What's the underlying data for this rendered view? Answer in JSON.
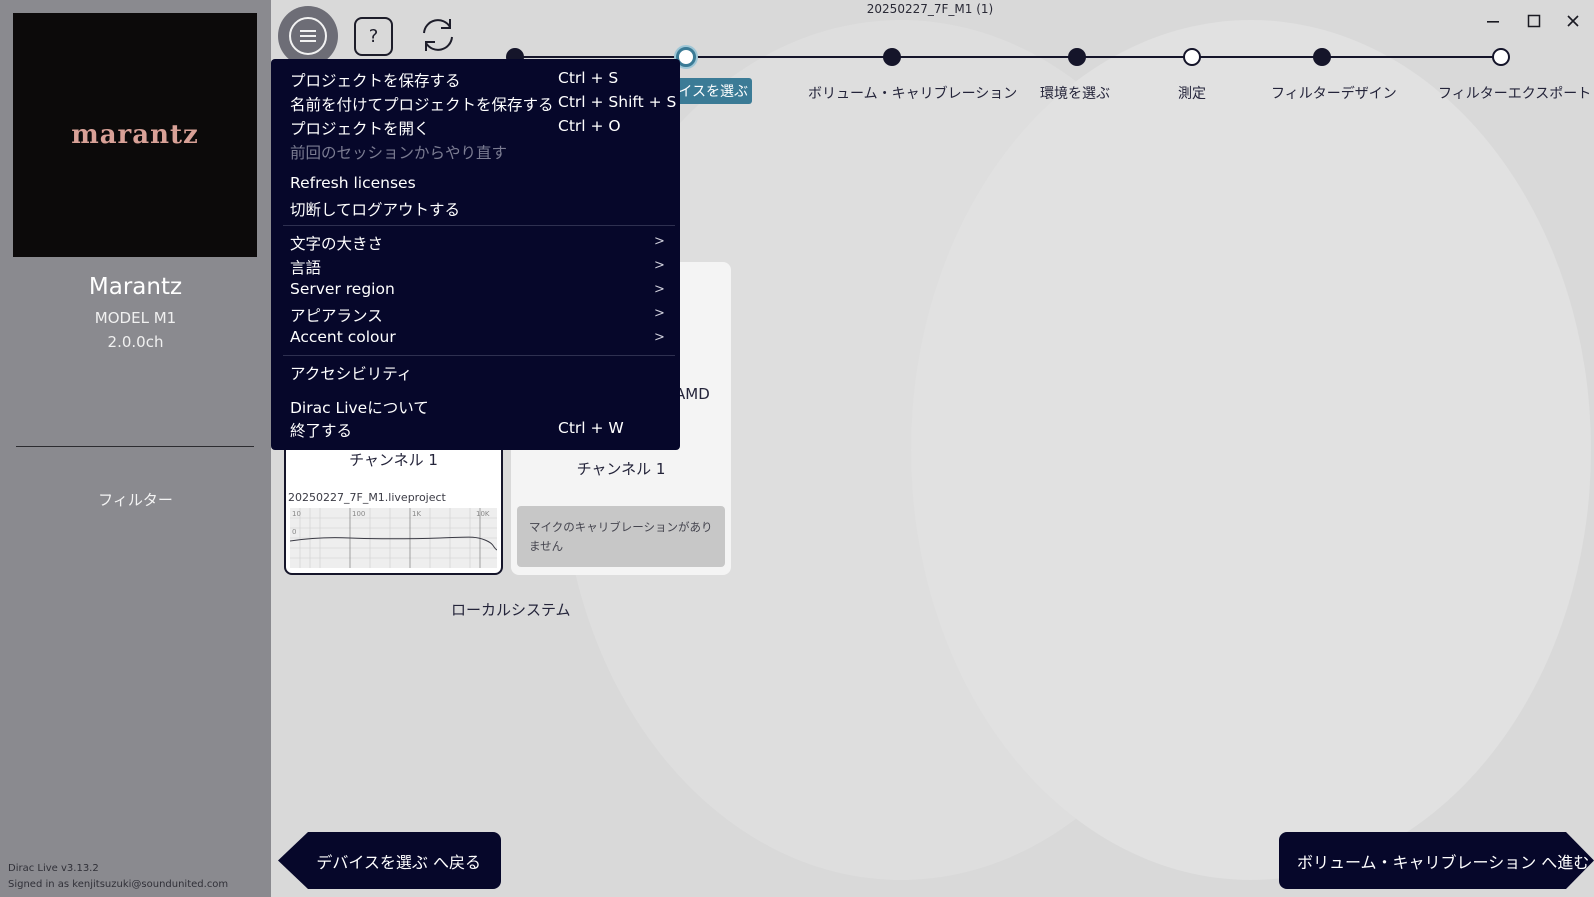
{
  "window": {
    "title": "20250227_7F_M1 (1)"
  },
  "sidebar": {
    "logo_text": "marantz",
    "device_name": "Marantz",
    "device_model": "MODEL M1",
    "device_channels": "2.0.0ch",
    "filter_label": "フィルター",
    "version": "Dirac Live v3.13.2",
    "signed_in": "Signed in as kenjitsuzuki@soundunited.com"
  },
  "toolbar": {
    "help_label": "?"
  },
  "steps": [
    {
      "label": "デバイスを選ぶ",
      "state": "current"
    },
    {
      "label": "ボリューム・キャリブレーション",
      "state": "done"
    },
    {
      "label": "環境を選ぶ",
      "state": "done"
    },
    {
      "label": "測定",
      "state": "todo"
    },
    {
      "label": "フィルターデザイン",
      "state": "done"
    },
    {
      "label": "フィルターエクスポート",
      "state": "todo"
    }
  ],
  "menu": {
    "items": [
      {
        "label": "プロジェクトを保存する",
        "shortcut": "Ctrl + S",
        "enabled": true
      },
      {
        "label": "名前を付けてプロジェクトを保存する",
        "shortcut": "Ctrl + Shift + S",
        "enabled": true
      },
      {
        "label": "プロジェクトを開く",
        "shortcut": "Ctrl + O",
        "enabled": true
      },
      {
        "label": "前回のセッションからやり直す",
        "shortcut": "",
        "enabled": false
      },
      {
        "label": "Refresh licenses",
        "shortcut": "",
        "enabled": true
      },
      {
        "label": "切断してログアウトする",
        "shortcut": "",
        "enabled": true
      },
      {
        "label": "文字の大きさ",
        "submenu": ">",
        "enabled": true
      },
      {
        "label": "言語",
        "submenu": ">",
        "enabled": true
      },
      {
        "label": "Server region",
        "submenu": ">",
        "enabled": true
      },
      {
        "label": "アピアランス",
        "submenu": ">",
        "enabled": true
      },
      {
        "label": "Accent colour",
        "submenu": ">",
        "enabled": true
      },
      {
        "label": "アクセシビリティ",
        "shortcut": "",
        "enabled": true
      },
      {
        "label": "Dirac Liveについて",
        "shortcut": "",
        "enabled": true
      },
      {
        "label": "終了する",
        "shortcut": "Ctrl + W",
        "enabled": true
      }
    ]
  },
  "cards": {
    "card_a": {
      "label": "チャンネル 1",
      "project": "20250227_7F_M1.liveproject",
      "graph_ticks": [
        "10",
        "100",
        "1K",
        "10K"
      ],
      "graph_y": "0"
    },
    "card_b": {
      "partial_text": "AMD",
      "label": "チャンネル 1",
      "note": "マイクのキャリブレーションがありません"
    },
    "group_label": "ローカルシステム"
  },
  "nav": {
    "back_label": "デバイスを選ぶ へ戻る",
    "next_label": "ボリューム・キャリブレーション へ進む"
  },
  "colors": {
    "accent": "#3b7b96",
    "dark": "#06072a",
    "sidebar": "#8a8a8f"
  }
}
